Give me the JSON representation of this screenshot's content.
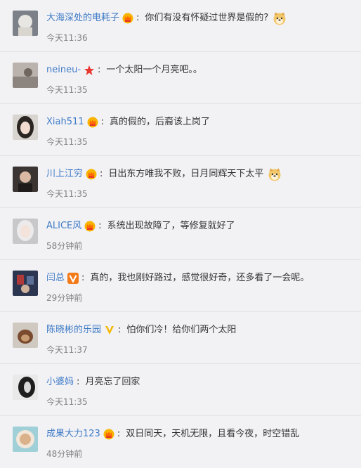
{
  "comments": [
    {
      "user": "大海深处的电耗子",
      "badge": "crown-vip",
      "text": "你们有没有怀疑过世界是假的?",
      "emoji": "doge",
      "time": "今天11:36"
    },
    {
      "user": "neineu-",
      "badge": "red-star",
      "text": "一个太阳一个月亮吧。。",
      "emoji": null,
      "time": "今天11:35"
    },
    {
      "user": "Xiah511",
      "badge": "crown-vip",
      "text": "真的假的，后裔该上岗了",
      "emoji": null,
      "time": "今天11:35"
    },
    {
      "user": "川上江穷",
      "badge": "crown-vip",
      "text": "日出东方唯我不败，日月同辉天下太平",
      "emoji": "doge",
      "time": "今天11:35"
    },
    {
      "user": "ALICE风",
      "badge": "crown-vip",
      "text": "系统出现故障了，等修复就好了",
      "emoji": null,
      "time": "58分钟前"
    },
    {
      "user": "闫总",
      "badge": "orange-v",
      "text": "真的，我也刚好路过，感觉很好奇，还多看了一会呢。",
      "emoji": null,
      "time": "29分钟前"
    },
    {
      "user": "陈晓彬的乐园",
      "badge": "yellow-v",
      "text": "怕你们冷！给你们两个太阳",
      "emoji": null,
      "time": "今天11:37"
    },
    {
      "user": "小婆妈",
      "badge": null,
      "text": "月亮忘了回家",
      "emoji": null,
      "time": "今天11:35"
    },
    {
      "user": "成果大力123",
      "badge": "crown-vip",
      "text": "双日同天，天机无限，且看今夜，时空错乱",
      "emoji": null,
      "time": "48分钟前"
    }
  ],
  "colors": {
    "background": "#f2f2f5",
    "username": "#3f7bc6",
    "text": "#333333",
    "time": "#808080",
    "divider": "#e3e3e8"
  }
}
